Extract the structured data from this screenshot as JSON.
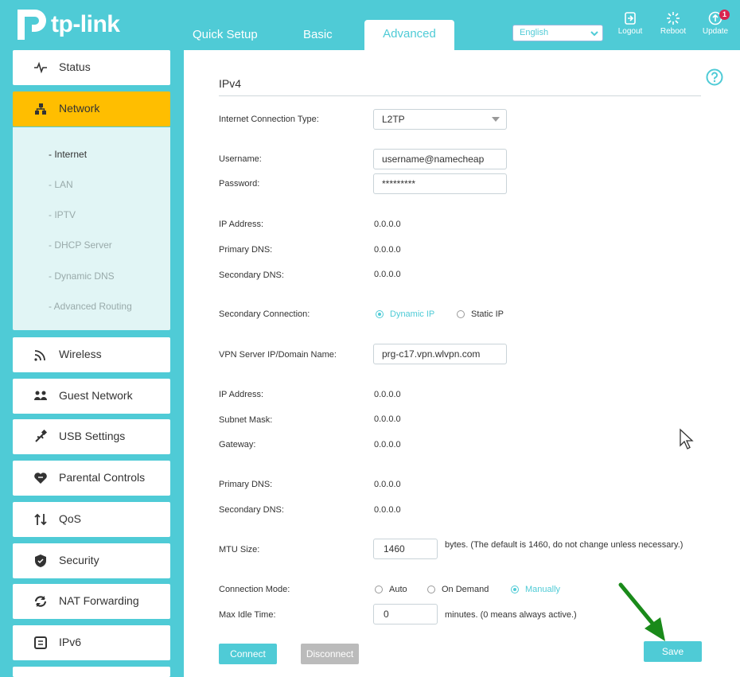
{
  "brand": {
    "name": "tp-link"
  },
  "top_tabs": [
    "Quick Setup",
    "Basic",
    "Advanced"
  ],
  "language": {
    "selected": "English"
  },
  "top_buttons": {
    "logout": "Logout",
    "reboot": "Reboot",
    "update": "Update",
    "update_badge": "1"
  },
  "sidebar": {
    "items": [
      "Status",
      "Network",
      "Wireless",
      "Guest Network",
      "USB Settings",
      "Parental Controls",
      "QoS",
      "Security",
      "NAT Forwarding",
      "IPv6"
    ],
    "network_sub": [
      "- Internet",
      "- LAN",
      "- IPTV",
      "- DHCP Server",
      "- Dynamic DNS",
      "- Advanced Routing"
    ]
  },
  "section": {
    "title": "IPv4"
  },
  "form": {
    "connection_type_label": "Internet Connection Type:",
    "connection_type_value": "L2TP",
    "username_label": "Username:",
    "username_value": "username@namecheap",
    "password_label": "Password:",
    "password_value": "*********",
    "ip_label": "IP Address:",
    "ip_value": "0.0.0.0",
    "pdns_label": "Primary DNS:",
    "pdns_value": "0.0.0.0",
    "sdns_label": "Secondary DNS:",
    "sdns_value": "0.0.0.0",
    "secondary_conn_label": "Secondary Connection:",
    "secondary_conn_opt1": "Dynamic IP",
    "secondary_conn_opt2": "Static IP",
    "vpn_label": "VPN Server IP/Domain Name:",
    "vpn_value": "prg-c17.vpn.wlvpn.com",
    "ip2_label": "IP Address:",
    "ip2_value": "0.0.0.0",
    "mask_label": "Subnet Mask:",
    "mask_value": "0.0.0.0",
    "gw_label": "Gateway:",
    "gw_value": "0.0.0.0",
    "pdns2_label": "Primary DNS:",
    "pdns2_value": "0.0.0.0",
    "sdns2_label": "Secondary DNS:",
    "sdns2_value": "0.0.0.0",
    "mtu_label": "MTU Size:",
    "mtu_value": "1460",
    "mtu_note": "bytes. (The default is 1460, do not change unless necessary.)",
    "mode_label": "Connection Mode:",
    "mode_auto": "Auto",
    "mode_demand": "On Demand",
    "mode_manual": "Manually",
    "idle_label": "Max Idle Time:",
    "idle_value": "0",
    "idle_note": "minutes. (0 means always active.)"
  },
  "buttons": {
    "connect": "Connect",
    "disconnect": "Disconnect",
    "save": "Save"
  },
  "colors": {
    "accent": "#4fcbd6",
    "active_nav": "#ffbe00",
    "arrow": "#1a8a1a"
  }
}
